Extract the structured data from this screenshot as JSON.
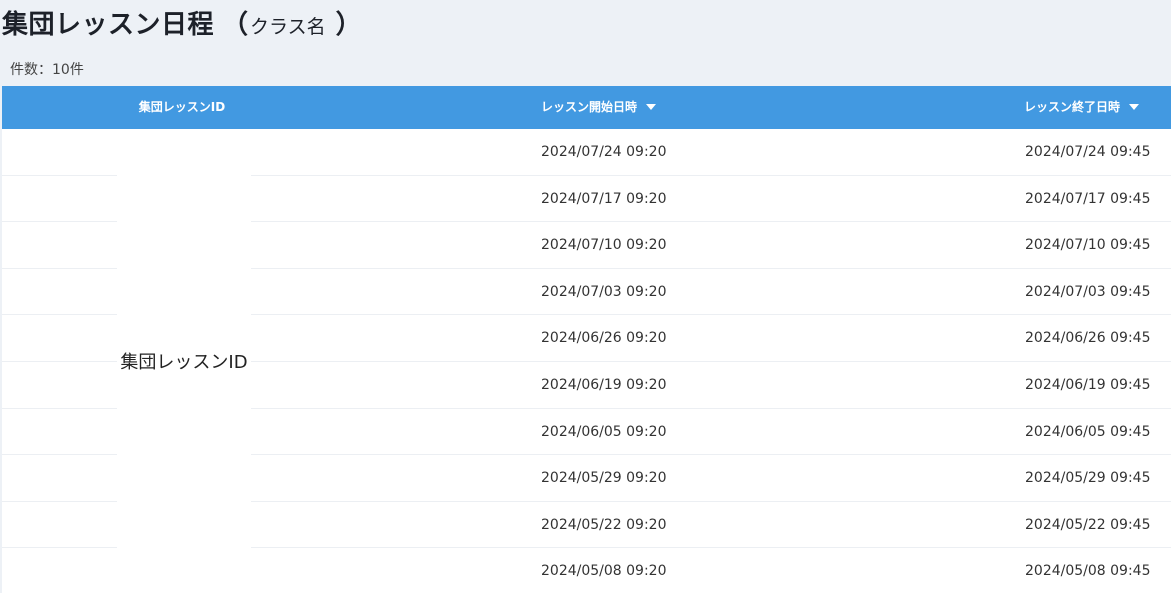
{
  "header": {
    "title": "集団レッスン日程",
    "paren_open": "（",
    "class_name": "クラス名",
    "paren_close": "）"
  },
  "summary": {
    "count_text": "件数：10件"
  },
  "table": {
    "columns": [
      {
        "label": "集団レッスンID",
        "sort_icon": "caret-down-icon",
        "sortable": false
      },
      {
        "label": "レッスン開始日時",
        "sort_icon": "caret-down-icon",
        "sortable": true
      },
      {
        "label": "レッスン終了日時",
        "sort_icon": "caret-down-icon",
        "sortable": true
      }
    ],
    "merged_id_label": "集団レッスンID",
    "rows": [
      {
        "start": "2024/07/24 09:20",
        "end": "2024/07/24 09:45"
      },
      {
        "start": "2024/07/17 09:20",
        "end": "2024/07/17 09:45"
      },
      {
        "start": "2024/07/10 09:20",
        "end": "2024/07/10 09:45"
      },
      {
        "start": "2024/07/03 09:20",
        "end": "2024/07/03 09:45"
      },
      {
        "start": "2024/06/26 09:20",
        "end": "2024/06/26 09:45"
      },
      {
        "start": "2024/06/19 09:20",
        "end": "2024/06/19 09:45"
      },
      {
        "start": "2024/06/05 09:20",
        "end": "2024/06/05 09:45"
      },
      {
        "start": "2024/05/29 09:20",
        "end": "2024/05/29 09:45"
      },
      {
        "start": "2024/05/22 09:20",
        "end": "2024/05/22 09:45"
      },
      {
        "start": "2024/05/08 09:20",
        "end": "2024/05/08 09:45"
      }
    ]
  },
  "colors": {
    "header_bg": "#4299e1",
    "page_bg": "#edf1f6",
    "row_border": "#eceff3"
  }
}
